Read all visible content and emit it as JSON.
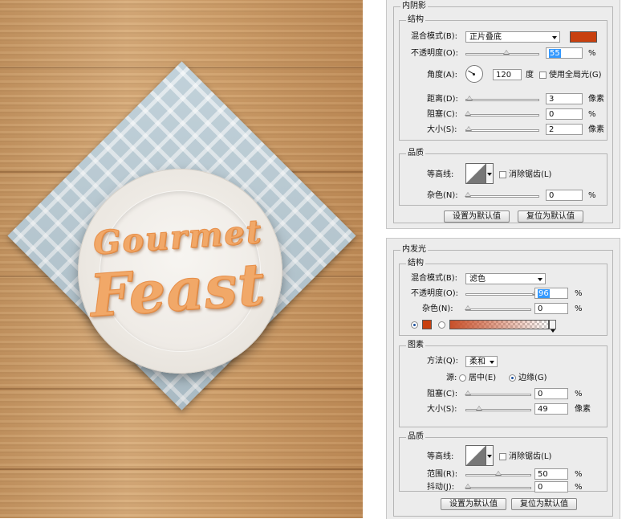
{
  "inner_shadow": {
    "title": "内阴影",
    "structure": {
      "legend": "结构",
      "blend_mode_label": "混合模式(B):",
      "blend_mode_value": "正片叠底",
      "color": "#c8400f",
      "opacity_label": "不透明度(O):",
      "opacity_value": "55",
      "opacity_unit": "%",
      "angle_label": "角度(A):",
      "angle_value": "120",
      "angle_unit": "度",
      "global_light_label": "使用全局光(G)",
      "distance_label": "距离(D):",
      "distance_value": "3",
      "distance_unit": "像素",
      "choke_label": "阻塞(C):",
      "choke_value": "0",
      "choke_unit": "%",
      "size_label": "大小(S):",
      "size_value": "2",
      "size_unit": "像素"
    },
    "quality": {
      "legend": "品质",
      "contour_label": "等高线:",
      "anti_alias_label": "消除锯齿(L)",
      "noise_label": "杂色(N):",
      "noise_value": "0",
      "noise_unit": "%"
    },
    "set_default_button": "设置为默认值",
    "reset_default_button": "复位为默认值"
  },
  "inner_glow": {
    "title": "内发光",
    "structure": {
      "legend": "结构",
      "blend_mode_label": "混合模式(B):",
      "blend_mode_value": "滤色",
      "opacity_label": "不透明度(O):",
      "opacity_value": "96",
      "opacity_unit": "%",
      "noise_label": "杂色(N):",
      "noise_value": "0",
      "noise_unit": "%",
      "color": "#c8400f"
    },
    "elements": {
      "legend": "图素",
      "technique_label": "方法(Q):",
      "technique_value": "柔和",
      "source_label": "源:",
      "source_center": "居中(E)",
      "source_edge": "边缘(G)",
      "choke_label": "阻塞(C):",
      "choke_value": "0",
      "choke_unit": "%",
      "size_label": "大小(S):",
      "size_value": "49",
      "size_unit": "像素"
    },
    "quality": {
      "legend": "品质",
      "contour_label": "等高线:",
      "anti_alias_label": "消除锯齿(L)",
      "range_label": "范围(R):",
      "range_value": "50",
      "range_unit": "%",
      "jitter_label": "抖动(J):",
      "jitter_value": "0",
      "jitter_unit": "%"
    },
    "set_default_button": "设置为默认值",
    "reset_default_button": "复位为默认值"
  },
  "artwork": {
    "line1": "Gourmet",
    "line2": "Feast"
  }
}
